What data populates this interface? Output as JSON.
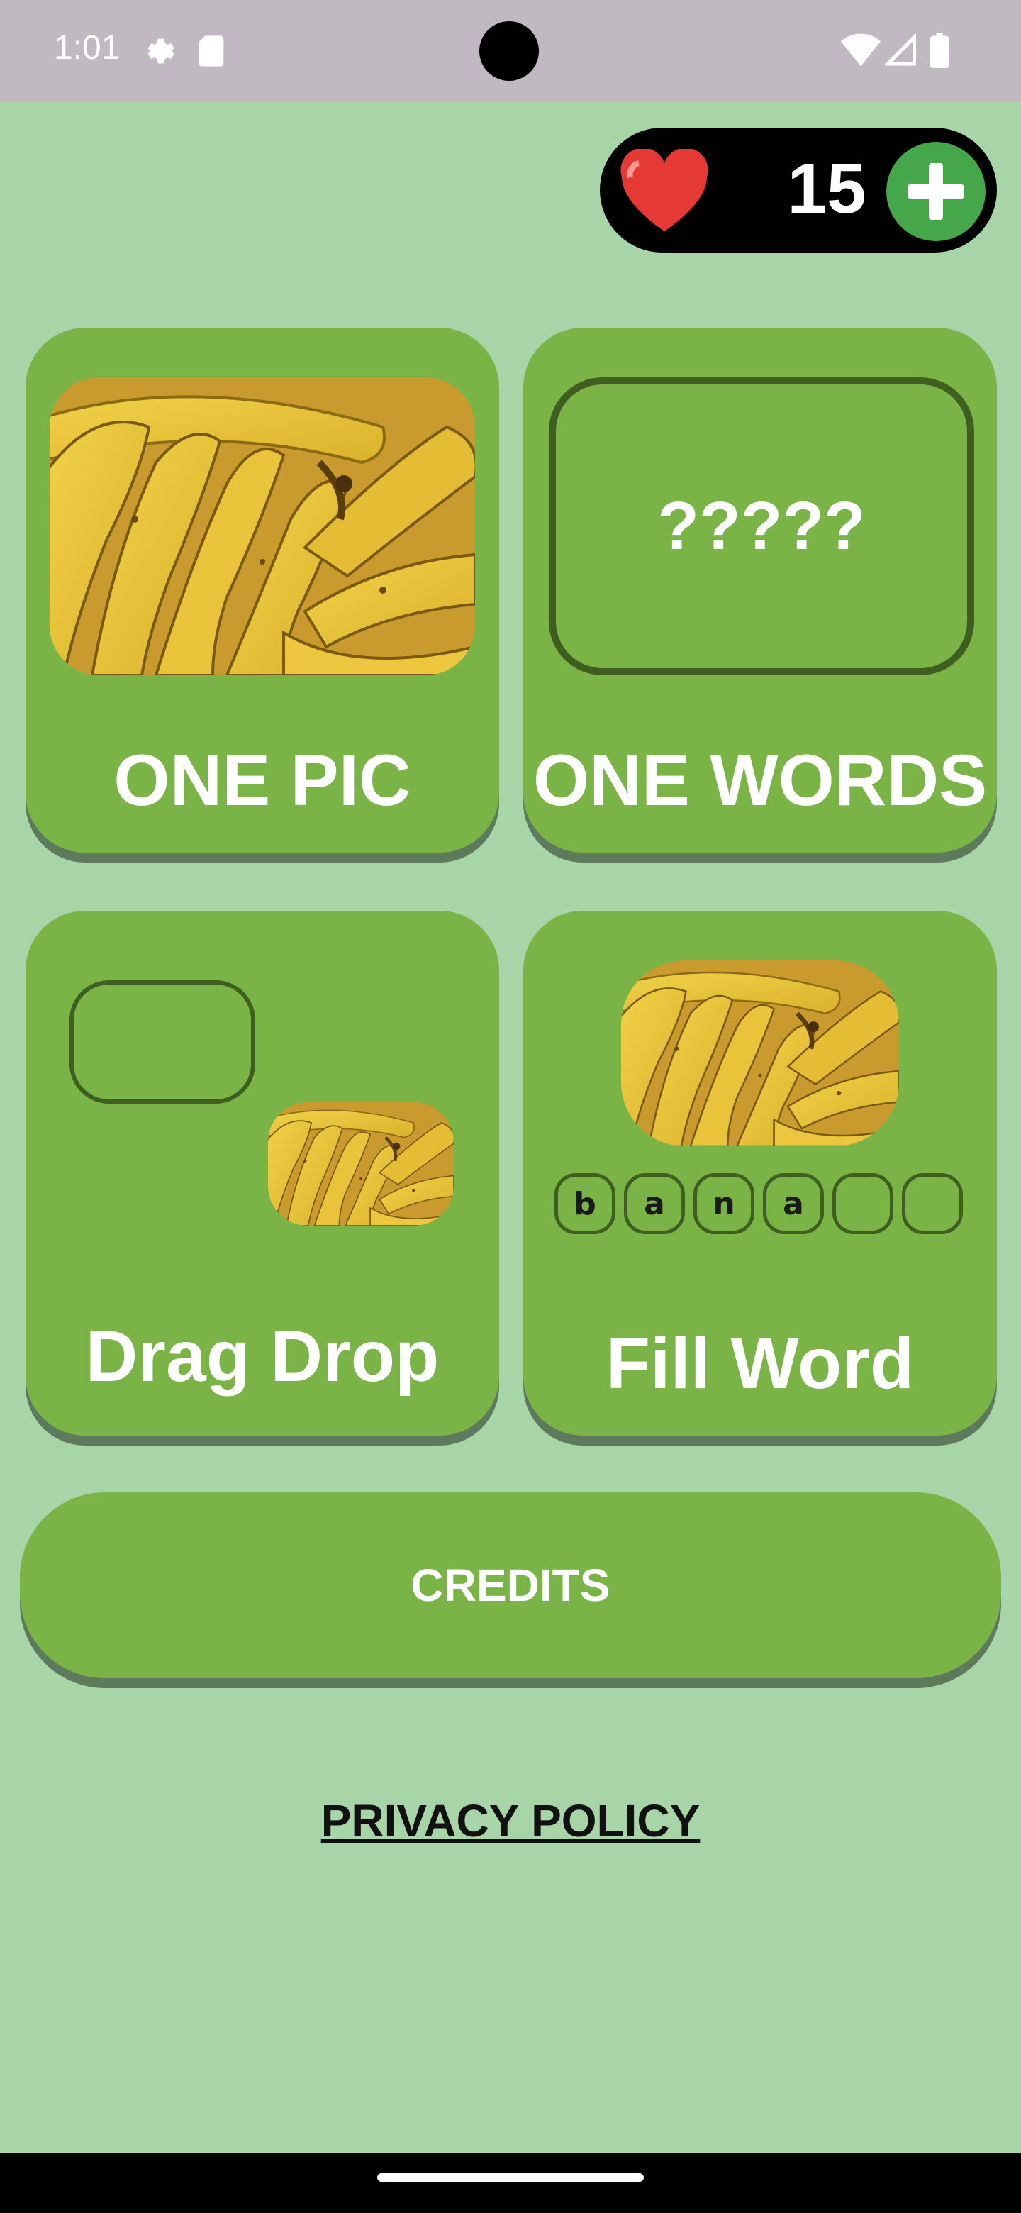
{
  "status_bar": {
    "time": "1:01",
    "icons": [
      "gear-icon",
      "sd-card-icon",
      "wifi-icon",
      "signal-icon",
      "battery-icon"
    ]
  },
  "lives": {
    "count": "15",
    "icon": "heart-icon",
    "add_icon": "plus-icon"
  },
  "modes": {
    "one_pic": {
      "title": "ONE PIC"
    },
    "one_words": {
      "title": "ONE WORDS",
      "placeholder": "?????"
    },
    "drag_drop": {
      "title": "Drag Drop"
    },
    "fill_word": {
      "title": "Fill Word",
      "letters": [
        "b",
        "a",
        "n",
        "a",
        "",
        ""
      ]
    }
  },
  "credits": {
    "label": "CREDITS"
  },
  "privacy": {
    "label": "PRIVACY POLICY"
  },
  "colors": {
    "background": "#a8d5a8",
    "card": "#7bb446",
    "card_shadow": "#5e7a5c",
    "accent_green": "#46a64a",
    "heart": "#e53935"
  }
}
